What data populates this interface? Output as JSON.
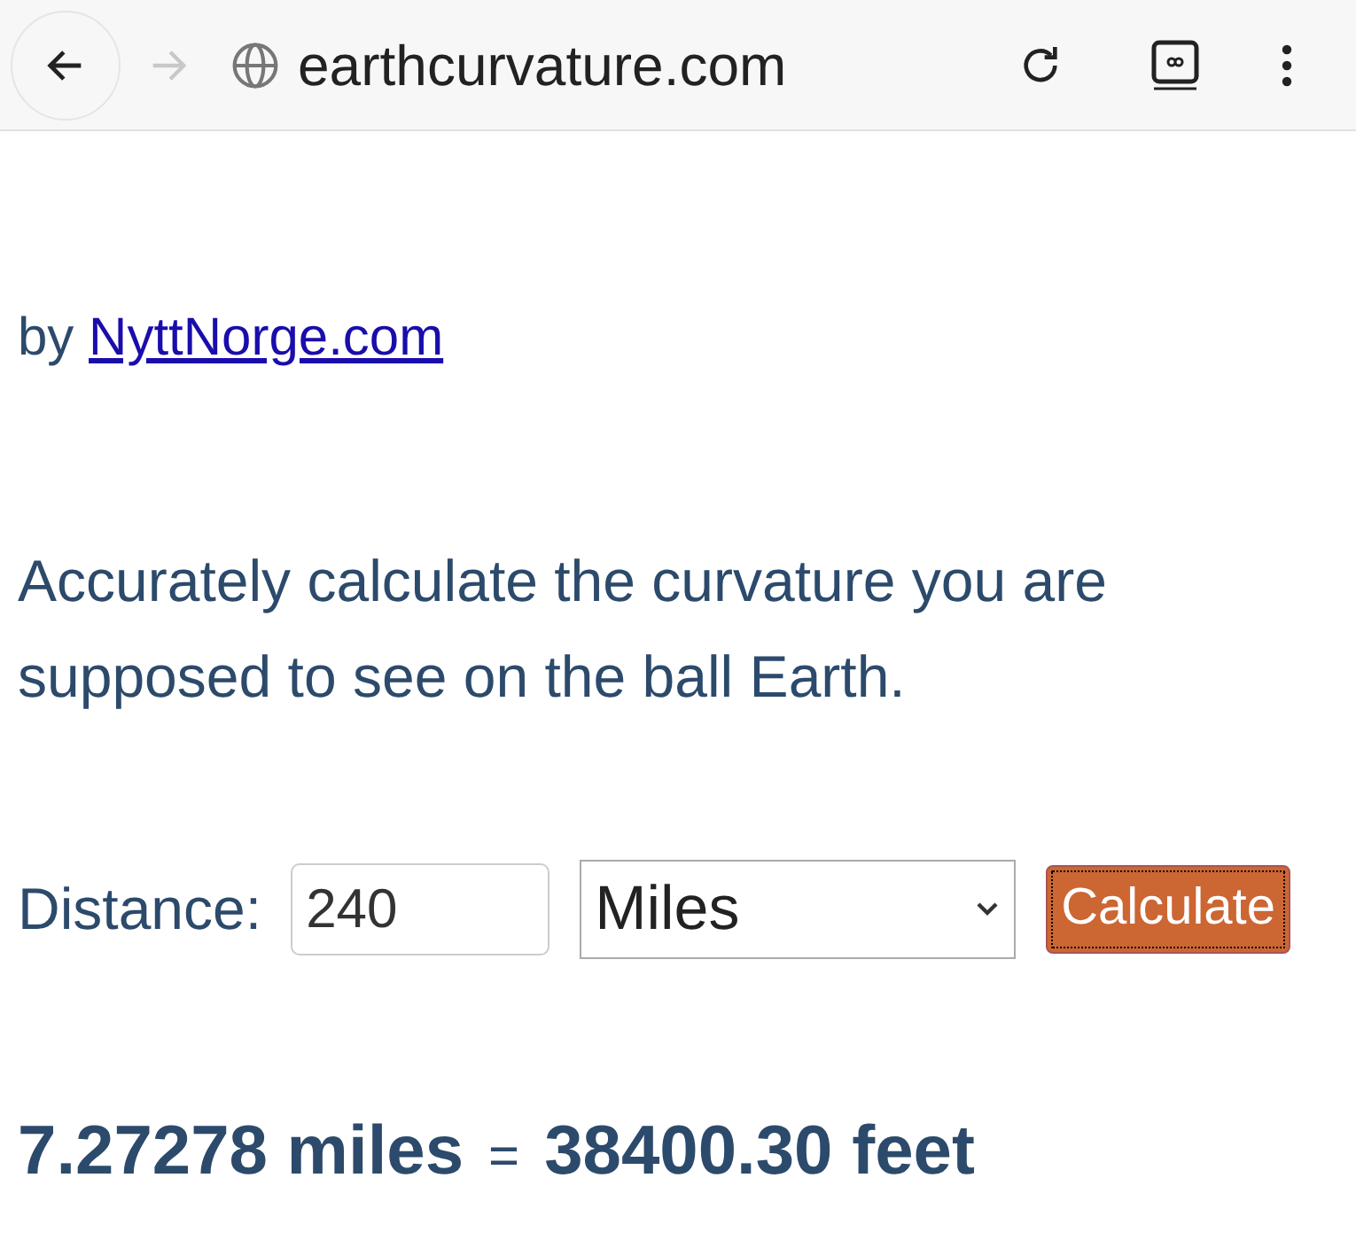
{
  "browser": {
    "url": "earthcurvature.com"
  },
  "byline": {
    "prefix": "by",
    "link": "NyttNorge.com"
  },
  "description": "Accurately calculate the curvature you are supposed to see on the ball Earth.",
  "form": {
    "label": "Distance:",
    "distance": "240",
    "unit": "Miles",
    "button": "Calculate"
  },
  "result": {
    "miles": "7.27278 miles",
    "equals": "=",
    "feet": "38400.30 feet"
  }
}
